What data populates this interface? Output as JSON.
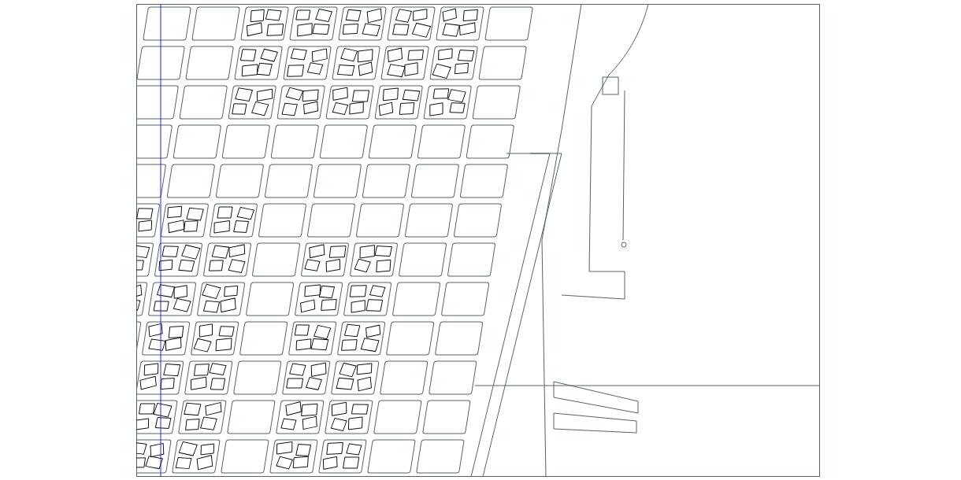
{
  "map": {
    "kind": "city-plan"
  }
}
